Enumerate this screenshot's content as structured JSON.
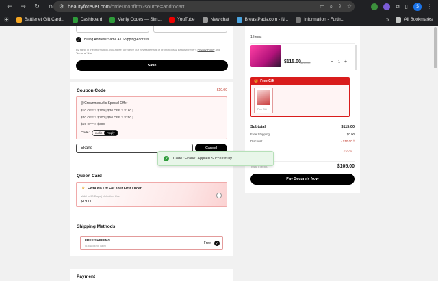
{
  "browser": {
    "url_host": "beautyforever.com",
    "url_path": "/order/confirm?source=addtocart",
    "bookmarks": [
      {
        "label": "Battlenet Gift Card...",
        "color": "#f5a623"
      },
      {
        "label": "Dashboard",
        "color": "#2e9b3a"
      },
      {
        "label": "Verify Codes — Sim...",
        "color": "#2e9b3a"
      },
      {
        "label": "YouTube",
        "color": "#e00"
      },
      {
        "label": "New chat",
        "color": "#999"
      },
      {
        "label": "BreastPads.com - N...",
        "color": "#4aa3df"
      },
      {
        "label": "Information - Furth...",
        "color": "#777"
      }
    ],
    "all_bookmarks": "All Bookmarks",
    "avatar_letter": "S"
  },
  "billing": {
    "same_as_shipping": "Billing Address Same As Shipping Address",
    "terms": "By filling in the information, you agree to receive our newest emails of promotions & Beautyforever's",
    "privacy": "Privacy Policy",
    "and": "and",
    "terms_link": "Terms of Use",
    "save": "Save"
  },
  "coupon": {
    "title": "Coupon Code",
    "discount": "-$10.00",
    "offer_title": "@Crownmecurlic Special Offer",
    "lines": [
      "$10 OFF > $109 | $30 OFF > $160 |",
      "$40 OFF > $200 | $50 OFF > $250 |",
      "$55 OFF > $300"
    ],
    "code_label": "Code:",
    "code_value": "curlic",
    "apply": "Apply",
    "input_value": "Ekane",
    "cancel": "Cancel"
  },
  "toast": {
    "text": "Code \"Ekane\" Applied Successfully"
  },
  "queen_card": {
    "title": "Queen Card",
    "offer": "Extra 8% Off For Your First Order",
    "valid": "Valid In 90 Days | Unlimited Use",
    "price": "$19.00"
  },
  "shipping": {
    "title": "Shipping Methods",
    "method": "FREE SHIPPING",
    "days": "(5-8 working days)",
    "price": "Free"
  },
  "payment": {
    "title": "Payment"
  },
  "summary": {
    "items_count": "1 Items",
    "price": "$115.00",
    "old_price": "$169.00",
    "qty": "1",
    "free_gift": "Free Gift",
    "gift_label": "Free Gift",
    "subtotal_label": "Subtotal",
    "subtotal": "$115.00",
    "free_shipping_label": "Free Shipping",
    "free_shipping": "$0.00",
    "discount_label": "Discount",
    "discount": "- $10.00",
    "discount_sub": "- $10.00",
    "total_label": "Total ( Items)",
    "total": "$105.00",
    "pay": "Pay Securely Now"
  }
}
